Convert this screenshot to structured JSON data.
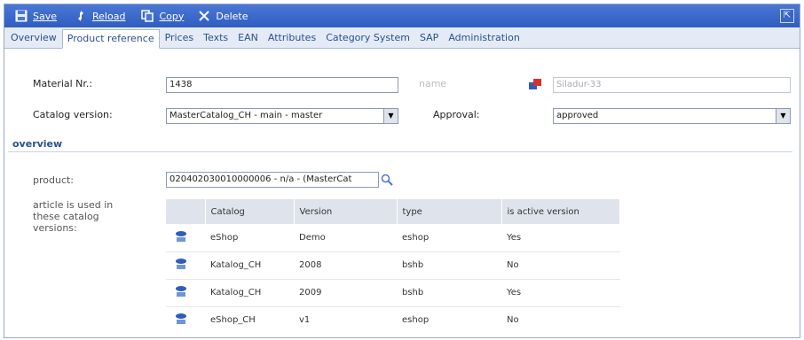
{
  "toolbar": {
    "save_label": "Save",
    "reload_label": "Reload",
    "copy_label": "Copy",
    "delete_label": "Delete"
  },
  "tabs": [
    {
      "label": "Overview"
    },
    {
      "label": "Product reference"
    },
    {
      "label": "Prices"
    },
    {
      "label": "Texts"
    },
    {
      "label": "EAN"
    },
    {
      "label": "Attributes"
    },
    {
      "label": "Category System"
    },
    {
      "label": "SAP"
    },
    {
      "label": "Administration"
    }
  ],
  "active_tab": "Product reference",
  "form": {
    "material_label": "Material Nr.:",
    "material_value": "1438",
    "name_label": "name",
    "name_value": "Siladur-33",
    "catalog_label": "Catalog version:",
    "catalog_value": "MasterCatalog_CH - main - master",
    "approval_label": "Approval:",
    "approval_value": "approved"
  },
  "overview": {
    "section_title": "overview",
    "product_label": "product:",
    "product_value": "020402030010000006 - n/a - (MasterCat",
    "used_in_label": "article is used in these catalog versions:"
  },
  "table": {
    "headers": [
      "Catalog",
      "Version",
      "type",
      "is active version"
    ],
    "rows": [
      {
        "catalog": "eShop",
        "version": "Demo",
        "type": "eshop",
        "active": "Yes"
      },
      {
        "catalog": "Katalog_CH",
        "version": "2008",
        "type": "bshb",
        "active": "No"
      },
      {
        "catalog": "Katalog_CH",
        "version": "2009",
        "type": "bshb",
        "active": "Yes"
      },
      {
        "catalog": "eShop_CH",
        "version": "v1",
        "type": "eshop",
        "active": "No"
      }
    ]
  },
  "colors": {
    "toolbar": "#3a66c9",
    "tab_bar": "#e4ebf6",
    "link": "#2a4f8f"
  }
}
